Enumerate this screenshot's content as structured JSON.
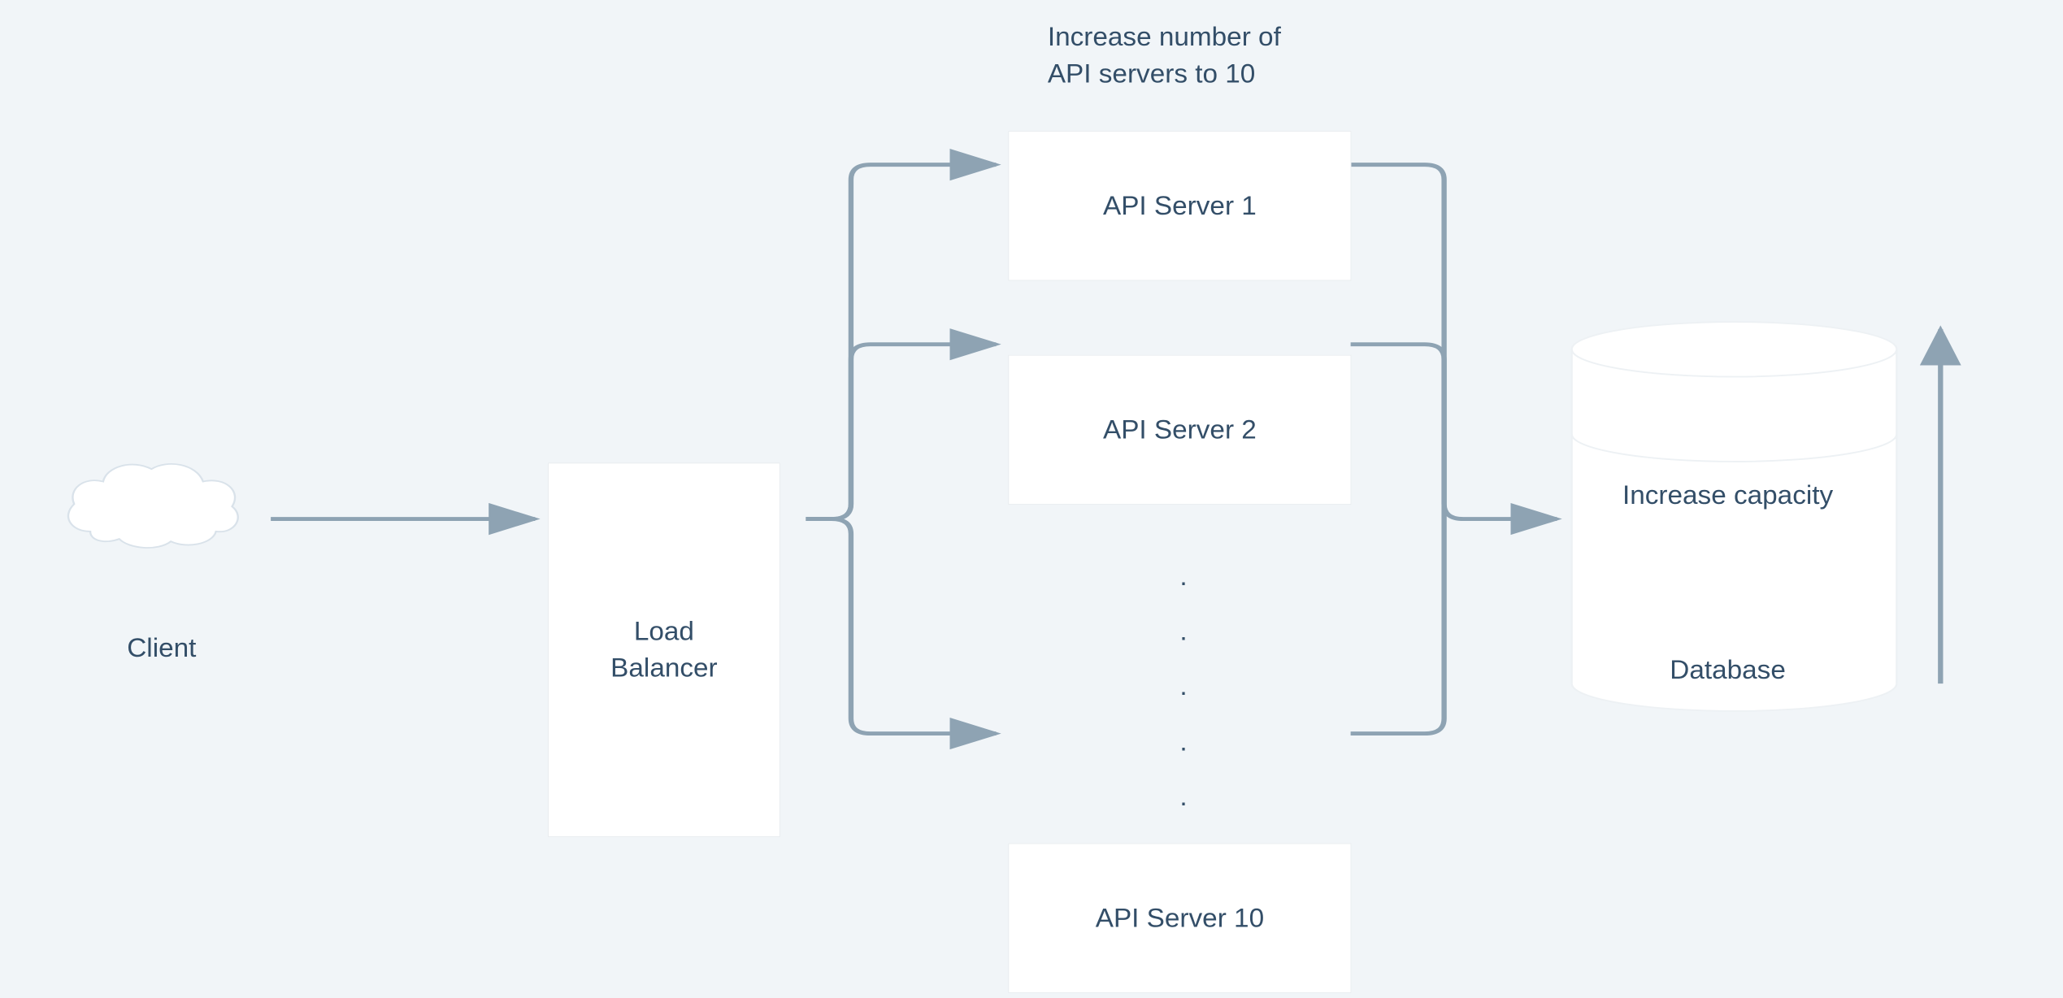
{
  "nodes": {
    "client": "Client",
    "load_balancer": "Load\nBalancer",
    "api_server_1": "API Server 1",
    "api_server_2": "API Server 2",
    "api_server_10": "API Server 10",
    "database": "Database",
    "db_capacity_label": "Increase capacity"
  },
  "annotations": {
    "api_scale": "Increase number of\nAPI servers to 10"
  },
  "ellipsis": ".\n.\n.\n.\n."
}
